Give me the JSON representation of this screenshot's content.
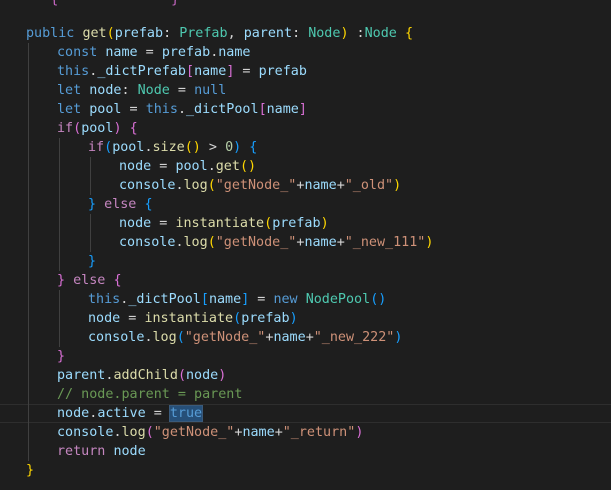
{
  "editor": {
    "partial_top_line": [
      {
        "t": "   ",
        "c": "punct"
      },
      {
        "t": "{",
        "c": "bracket2"
      },
      {
        "t": "              ",
        "c": "punct"
      },
      {
        "t": "}",
        "c": "bracket2"
      }
    ],
    "lines": [
      {
        "indent": 0,
        "tokens": [
          {
            "t": "public",
            "c": "keyword"
          },
          {
            "t": " ",
            "c": "punct"
          },
          {
            "t": "get",
            "c": "function"
          },
          {
            "t": "(",
            "c": "bracket1"
          },
          {
            "t": "prefab",
            "c": "param"
          },
          {
            "t": ": ",
            "c": "punct"
          },
          {
            "t": "Prefab",
            "c": "type"
          },
          {
            "t": ", ",
            "c": "punct"
          },
          {
            "t": "parent",
            "c": "param"
          },
          {
            "t": ": ",
            "c": "punct"
          },
          {
            "t": "Node",
            "c": "type"
          },
          {
            "t": ")",
            "c": "bracket1"
          },
          {
            "t": " :",
            "c": "punct"
          },
          {
            "t": "Node",
            "c": "type"
          },
          {
            "t": " ",
            "c": "punct"
          },
          {
            "t": "{",
            "c": "bracket1"
          }
        ]
      },
      {
        "indent": 1,
        "tokens": [
          {
            "t": "const",
            "c": "keyword"
          },
          {
            "t": " ",
            "c": "punct"
          },
          {
            "t": "name",
            "c": "variable"
          },
          {
            "t": " = ",
            "c": "punct"
          },
          {
            "t": "prefab",
            "c": "variable"
          },
          {
            "t": ".",
            "c": "punct"
          },
          {
            "t": "name",
            "c": "variable"
          }
        ]
      },
      {
        "indent": 1,
        "tokens": [
          {
            "t": "this",
            "c": "keyword"
          },
          {
            "t": ".",
            "c": "punct"
          },
          {
            "t": "_dictPrefab",
            "c": "variable"
          },
          {
            "t": "[",
            "c": "bracket2"
          },
          {
            "t": "name",
            "c": "variable"
          },
          {
            "t": "]",
            "c": "bracket2"
          },
          {
            "t": " = ",
            "c": "punct"
          },
          {
            "t": "prefab",
            "c": "variable"
          }
        ]
      },
      {
        "indent": 1,
        "tokens": [
          {
            "t": "let",
            "c": "keyword"
          },
          {
            "t": " ",
            "c": "punct"
          },
          {
            "t": "node",
            "c": "variable"
          },
          {
            "t": ": ",
            "c": "punct"
          },
          {
            "t": "Node",
            "c": "type"
          },
          {
            "t": " = ",
            "c": "punct"
          },
          {
            "t": "null",
            "c": "keyword"
          }
        ]
      },
      {
        "indent": 1,
        "tokens": [
          {
            "t": "let",
            "c": "keyword"
          },
          {
            "t": " ",
            "c": "punct"
          },
          {
            "t": "pool",
            "c": "variable"
          },
          {
            "t": " = ",
            "c": "punct"
          },
          {
            "t": "this",
            "c": "keyword"
          },
          {
            "t": ".",
            "c": "punct"
          },
          {
            "t": "_dictPool",
            "c": "variable"
          },
          {
            "t": "[",
            "c": "bracket2"
          },
          {
            "t": "name",
            "c": "variable"
          },
          {
            "t": "]",
            "c": "bracket2"
          }
        ]
      },
      {
        "indent": 1,
        "tokens": [
          {
            "t": "if",
            "c": "control"
          },
          {
            "t": "(",
            "c": "bracket2"
          },
          {
            "t": "pool",
            "c": "variable"
          },
          {
            "t": ")",
            "c": "bracket2"
          },
          {
            "t": " ",
            "c": "punct"
          },
          {
            "t": "{",
            "c": "bracket2"
          }
        ]
      },
      {
        "indent": 2,
        "tokens": [
          {
            "t": "if",
            "c": "control"
          },
          {
            "t": "(",
            "c": "bracket3"
          },
          {
            "t": "pool",
            "c": "variable"
          },
          {
            "t": ".",
            "c": "punct"
          },
          {
            "t": "size",
            "c": "function"
          },
          {
            "t": "()",
            "c": "bracket1"
          },
          {
            "t": " > ",
            "c": "punct"
          },
          {
            "t": "0",
            "c": "number"
          },
          {
            "t": ")",
            "c": "bracket3"
          },
          {
            "t": " ",
            "c": "punct"
          },
          {
            "t": "{",
            "c": "bracket3"
          }
        ]
      },
      {
        "indent": 3,
        "tokens": [
          {
            "t": "node",
            "c": "variable"
          },
          {
            "t": " = ",
            "c": "punct"
          },
          {
            "t": "pool",
            "c": "variable"
          },
          {
            "t": ".",
            "c": "punct"
          },
          {
            "t": "get",
            "c": "function"
          },
          {
            "t": "()",
            "c": "bracket1"
          }
        ]
      },
      {
        "indent": 3,
        "tokens": [
          {
            "t": "console",
            "c": "variable"
          },
          {
            "t": ".",
            "c": "punct"
          },
          {
            "t": "log",
            "c": "function"
          },
          {
            "t": "(",
            "c": "bracket1"
          },
          {
            "t": "\"getNode_\"",
            "c": "string"
          },
          {
            "t": "+",
            "c": "punct"
          },
          {
            "t": "name",
            "c": "variable"
          },
          {
            "t": "+",
            "c": "punct"
          },
          {
            "t": "\"_old\"",
            "c": "string"
          },
          {
            "t": ")",
            "c": "bracket1"
          }
        ]
      },
      {
        "indent": 2,
        "tokens": [
          {
            "t": "}",
            "c": "bracket3"
          },
          {
            "t": " ",
            "c": "punct"
          },
          {
            "t": "else",
            "c": "control"
          },
          {
            "t": " ",
            "c": "punct"
          },
          {
            "t": "{",
            "c": "bracket3"
          }
        ]
      },
      {
        "indent": 3,
        "tokens": [
          {
            "t": "node",
            "c": "variable"
          },
          {
            "t": " = ",
            "c": "punct"
          },
          {
            "t": "instantiate",
            "c": "function"
          },
          {
            "t": "(",
            "c": "bracket1"
          },
          {
            "t": "prefab",
            "c": "variable"
          },
          {
            "t": ")",
            "c": "bracket1"
          }
        ]
      },
      {
        "indent": 3,
        "tokens": [
          {
            "t": "console",
            "c": "variable"
          },
          {
            "t": ".",
            "c": "punct"
          },
          {
            "t": "log",
            "c": "function"
          },
          {
            "t": "(",
            "c": "bracket1"
          },
          {
            "t": "\"getNode_\"",
            "c": "string"
          },
          {
            "t": "+",
            "c": "punct"
          },
          {
            "t": "name",
            "c": "variable"
          },
          {
            "t": "+",
            "c": "punct"
          },
          {
            "t": "\"_new_111\"",
            "c": "string"
          },
          {
            "t": ")",
            "c": "bracket1"
          }
        ]
      },
      {
        "indent": 2,
        "tokens": [
          {
            "t": "}",
            "c": "bracket3"
          }
        ]
      },
      {
        "indent": 1,
        "tokens": [
          {
            "t": "}",
            "c": "bracket2"
          },
          {
            "t": " ",
            "c": "punct"
          },
          {
            "t": "else",
            "c": "control"
          },
          {
            "t": " ",
            "c": "punct"
          },
          {
            "t": "{",
            "c": "bracket2"
          }
        ]
      },
      {
        "indent": 2,
        "tokens": [
          {
            "t": "this",
            "c": "keyword"
          },
          {
            "t": ".",
            "c": "punct"
          },
          {
            "t": "_dictPool",
            "c": "variable"
          },
          {
            "t": "[",
            "c": "bracket3"
          },
          {
            "t": "name",
            "c": "variable"
          },
          {
            "t": "]",
            "c": "bracket3"
          },
          {
            "t": " = ",
            "c": "punct"
          },
          {
            "t": "new",
            "c": "keyword"
          },
          {
            "t": " ",
            "c": "punct"
          },
          {
            "t": "NodePool",
            "c": "type"
          },
          {
            "t": "()",
            "c": "bracket3"
          }
        ]
      },
      {
        "indent": 2,
        "tokens": [
          {
            "t": "node",
            "c": "variable"
          },
          {
            "t": " = ",
            "c": "punct"
          },
          {
            "t": "instantiate",
            "c": "function"
          },
          {
            "t": "(",
            "c": "bracket3"
          },
          {
            "t": "prefab",
            "c": "variable"
          },
          {
            "t": ")",
            "c": "bracket3"
          }
        ]
      },
      {
        "indent": 2,
        "tokens": [
          {
            "t": "console",
            "c": "variable"
          },
          {
            "t": ".",
            "c": "punct"
          },
          {
            "t": "log",
            "c": "function"
          },
          {
            "t": "(",
            "c": "bracket3"
          },
          {
            "t": "\"getNode_\"",
            "c": "string"
          },
          {
            "t": "+",
            "c": "punct"
          },
          {
            "t": "name",
            "c": "variable"
          },
          {
            "t": "+",
            "c": "punct"
          },
          {
            "t": "\"_new_222\"",
            "c": "string"
          },
          {
            "t": ")",
            "c": "bracket3"
          }
        ]
      },
      {
        "indent": 1,
        "tokens": [
          {
            "t": "}",
            "c": "bracket2"
          }
        ]
      },
      {
        "indent": 1,
        "tokens": [
          {
            "t": "parent",
            "c": "variable"
          },
          {
            "t": ".",
            "c": "punct"
          },
          {
            "t": "addChild",
            "c": "function"
          },
          {
            "t": "(",
            "c": "bracket2"
          },
          {
            "t": "node",
            "c": "variable"
          },
          {
            "t": ")",
            "c": "bracket2"
          }
        ]
      },
      {
        "indent": 1,
        "tokens": [
          {
            "t": "// node.parent = parent",
            "c": "comment"
          }
        ]
      },
      {
        "indent": 1,
        "current": true,
        "tokens": [
          {
            "t": "node",
            "c": "variable"
          },
          {
            "t": ".",
            "c": "punct"
          },
          {
            "t": "active",
            "c": "variable"
          },
          {
            "t": " = ",
            "c": "punct"
          },
          {
            "t": "true",
            "c": "keyword",
            "selected": true
          }
        ]
      },
      {
        "indent": 1,
        "tokens": [
          {
            "t": "console",
            "c": "variable"
          },
          {
            "t": ".",
            "c": "punct"
          },
          {
            "t": "log",
            "c": "function"
          },
          {
            "t": "(",
            "c": "bracket2"
          },
          {
            "t": "\"getNode_\"",
            "c": "string"
          },
          {
            "t": "+",
            "c": "punct"
          },
          {
            "t": "name",
            "c": "variable"
          },
          {
            "t": "+",
            "c": "punct"
          },
          {
            "t": "\"_return\"",
            "c": "string"
          },
          {
            "t": ")",
            "c": "bracket2"
          }
        ]
      },
      {
        "indent": 1,
        "tokens": [
          {
            "t": "return",
            "c": "control"
          },
          {
            "t": " ",
            "c": "punct"
          },
          {
            "t": "node",
            "c": "variable"
          }
        ]
      },
      {
        "indent": 0,
        "tokens": [
          {
            "t": "}",
            "c": "bracket1"
          }
        ]
      }
    ]
  }
}
